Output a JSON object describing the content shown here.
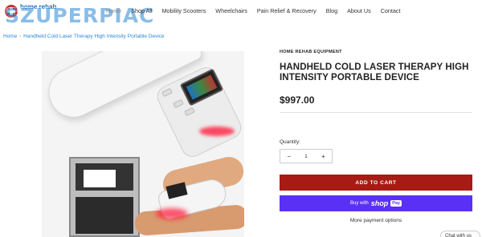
{
  "brand": {
    "logo_text": "home rehab",
    "watermark": "SZUPERPIAC",
    "accent": "#2a88d6"
  },
  "nav": {
    "items": [
      "Home",
      "Shop All",
      "Mobility Scooters",
      "Wheelchairs",
      "Pain Relief & Recovery",
      "Blog",
      "About Us",
      "Contact"
    ]
  },
  "breadcrumb": {
    "home": "Home",
    "separator": "›",
    "current": "Handheld Cold Laser Therapy High Intensity Portable Device"
  },
  "product": {
    "vendor": "HOME REHAB EQUIPMENT",
    "title": "HANDHELD COLD LASER THERAPY HIGH INTENSITY PORTABLE DEVICE",
    "price": "$997.00",
    "quantity_label": "Quantity:",
    "quantity_value": "1",
    "minus": "−",
    "plus": "+",
    "add_to_cart": "ADD TO CART",
    "buy_with": "Buy with",
    "shop_word": "shop",
    "pay_word": "Pay",
    "more_payment": "More payment options",
    "add_color": "#a81a14",
    "shop_color": "#5a31f4"
  },
  "chat": {
    "label": "Chat with us"
  }
}
